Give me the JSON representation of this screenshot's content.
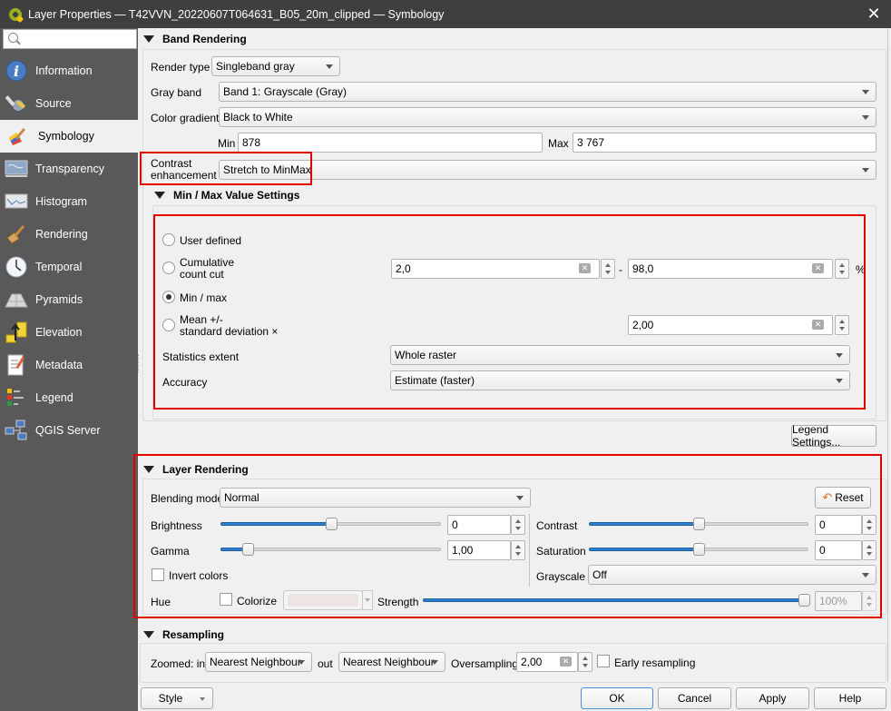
{
  "window": {
    "title": "Layer Properties — T42VVN_20220607T064631_B05_20m_clipped — Symbology"
  },
  "sidebar": {
    "search_placeholder": "",
    "items": [
      {
        "label": "Information",
        "icon": "info-icon"
      },
      {
        "label": "Source",
        "icon": "source-settings-icon"
      },
      {
        "label": "Symbology",
        "icon": "paintbrush-icon",
        "active": true
      },
      {
        "label": "Transparency",
        "icon": "transparency-icon"
      },
      {
        "label": "Histogram",
        "icon": "histogram-icon"
      },
      {
        "label": "Rendering",
        "icon": "rendering-brush-icon"
      },
      {
        "label": "Temporal",
        "icon": "clock-icon"
      },
      {
        "label": "Pyramids",
        "icon": "pyramids-icon"
      },
      {
        "label": "Elevation",
        "icon": "elevation-icon"
      },
      {
        "label": "Metadata",
        "icon": "metadata-icon"
      },
      {
        "label": "Legend",
        "icon": "legend-icon"
      },
      {
        "label": "QGIS Server",
        "icon": "server-icon"
      }
    ]
  },
  "band_rendering": {
    "title": "Band Rendering",
    "render_type_label": "Render type",
    "render_type": "Singleband gray",
    "gray_band_label": "Gray band",
    "gray_band": "Band 1: Grayscale (Gray)",
    "color_gradient_label": "Color gradient",
    "color_gradient": "Black to White",
    "min_label": "Min",
    "min": "878",
    "max_label": "Max",
    "max": "3 767",
    "contrast_label_1": "Contrast",
    "contrast_label_2": "enhancement",
    "contrast": "Stretch to MinMax"
  },
  "minmax": {
    "title": "Min / Max Value Settings",
    "user_defined": "User defined",
    "cumulative_1": "Cumulative",
    "cumulative_2": "count cut",
    "cum_low": "2,0",
    "dash": "-",
    "cum_high": "98,0",
    "percent": "%",
    "minmax": "Min / max",
    "mean_1": "Mean +/-",
    "mean_2": "standard deviation ×",
    "stddev": "2,00",
    "selected": "Min / max",
    "stats_extent_label": "Statistics extent",
    "stats_extent": "Whole raster",
    "accuracy_label": "Accuracy",
    "accuracy": "Estimate (faster)"
  },
  "legend_settings": "Legend Settings...",
  "layer_rendering": {
    "title": "Layer Rendering",
    "blending_label": "Blending mode",
    "blending": "Normal",
    "reset": "Reset",
    "brightness_label": "Brightness",
    "brightness": "0",
    "brightness_pos": 0.5,
    "contrast_label": "Contrast",
    "contrast": "0",
    "contrast_pos": 0.5,
    "gamma_label": "Gamma",
    "gamma": "1,00",
    "gamma_pos": 0.11,
    "saturation_label": "Saturation",
    "saturation": "0",
    "saturation_pos": 0.5,
    "invert_label": "Invert colors",
    "invert": false,
    "grayscale_label": "Grayscale",
    "grayscale": "Off",
    "hue_label": "Hue",
    "colorize_label": "Colorize",
    "colorize": false,
    "colorize_color": "#ede4e4",
    "strength_label": "Strength",
    "strength": "100%",
    "strength_pos": 1.0
  },
  "resampling": {
    "title": "Resampling",
    "zoomed_in_label": "Zoomed: in",
    "zoomed_in": "Nearest Neighbour",
    "out_label": "out",
    "zoomed_out": "Nearest Neighbour",
    "oversampling_label": "Oversampling",
    "oversampling": "2,00",
    "early_label": "Early resampling",
    "early": false
  },
  "footer": {
    "style": "Style",
    "ok": "OK",
    "cancel": "Cancel",
    "apply": "Apply",
    "help": "Help"
  },
  "colors": {
    "highlight": "#e00000",
    "accent": "#2f7fd0",
    "sidebar_bg": "#595959",
    "titlebar_bg": "#3f3f3f"
  }
}
